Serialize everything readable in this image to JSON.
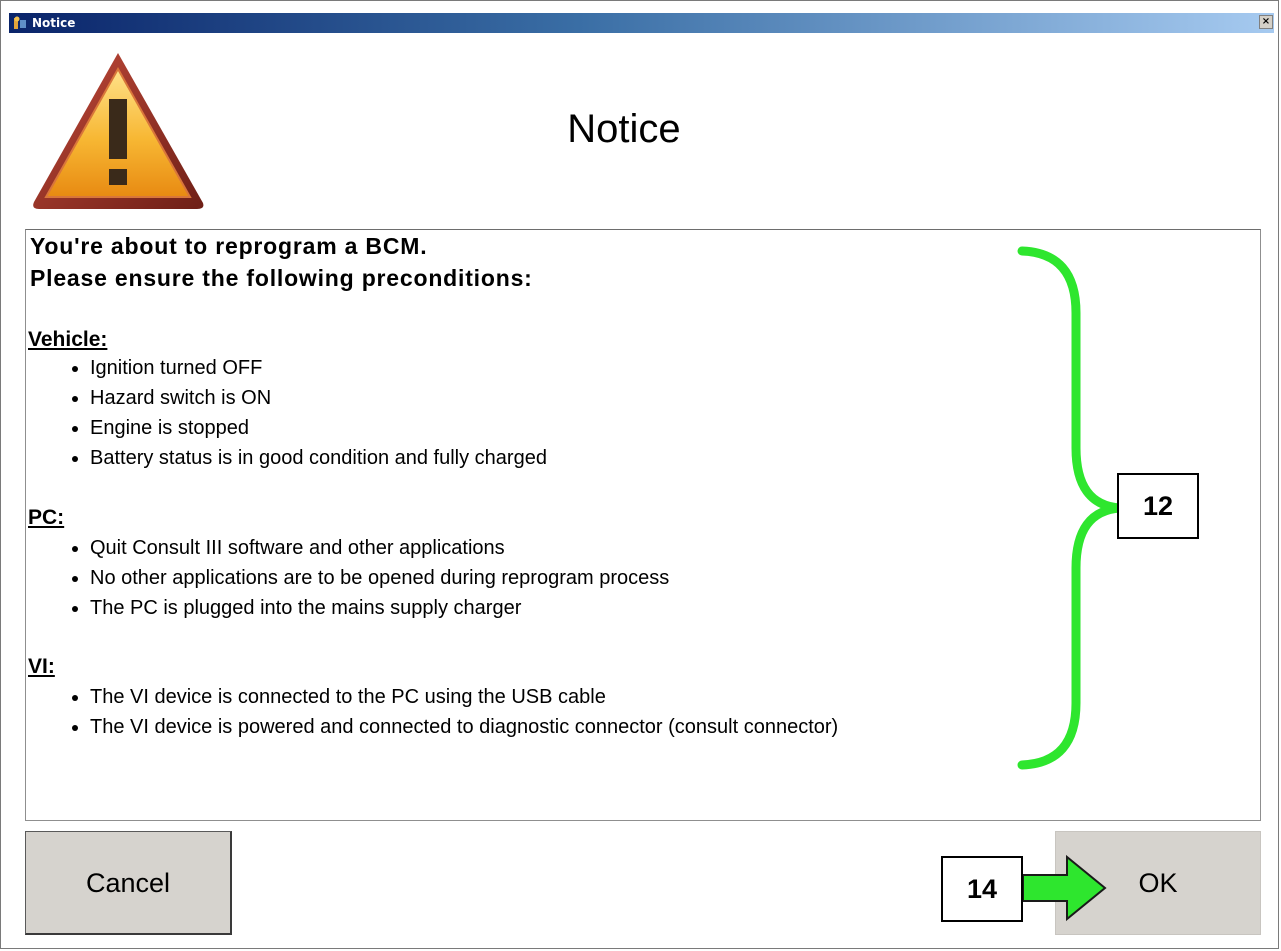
{
  "window": {
    "title": "Notice",
    "close_label": "×"
  },
  "dialog": {
    "heading": "Notice",
    "intro_line1": "You're about to reprogram a BCM.",
    "intro_line2": "Please ensure the following preconditions:",
    "sections": [
      {
        "title": "Vehicle:",
        "items": [
          "Ignition turned OFF",
          "Hazard switch is ON",
          "Engine is stopped",
          "Battery status is in good condition and fully charged"
        ]
      },
      {
        "title": "PC:",
        "items": [
          "Quit Consult III software and other applications",
          "No other applications are to be opened during reprogram process",
          "The PC is plugged into the mains supply charger"
        ]
      },
      {
        "title": "VI:",
        "items": [
          "The VI device is connected to the PC using the USB cable",
          "The VI device is powered and connected to diagnostic connector (consult connector)"
        ]
      }
    ]
  },
  "buttons": {
    "cancel_label": "Cancel",
    "ok_label": "OK"
  },
  "annotations": {
    "brace_callout": "12",
    "arrow_callout": "14",
    "highlight_color": "#2ee62e"
  },
  "icons": {
    "app_icon": "app-icon",
    "warning": "warning-triangle-icon"
  }
}
